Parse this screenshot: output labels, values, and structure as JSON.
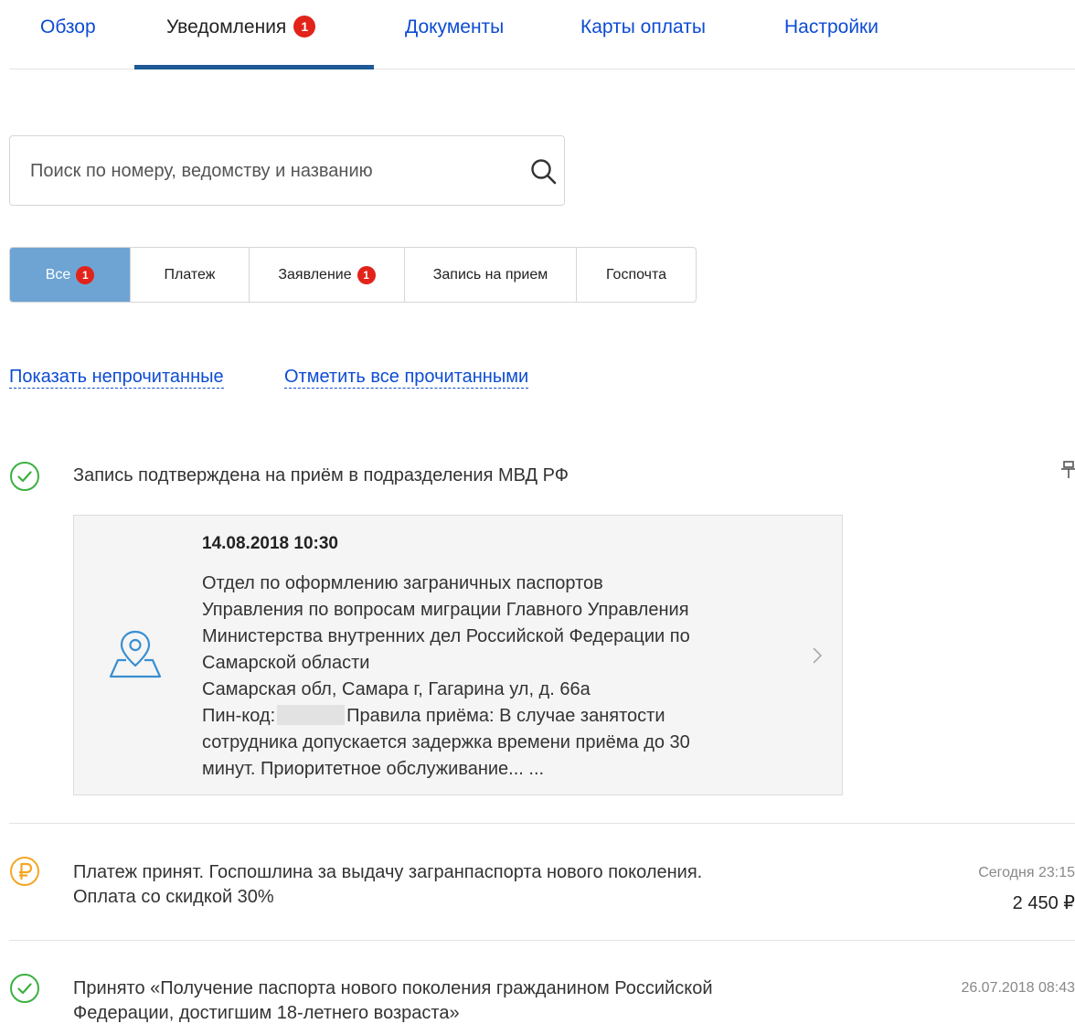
{
  "tabs": [
    {
      "label": "Обзор"
    },
    {
      "label": "Уведомления",
      "badge": "1"
    },
    {
      "label": "Документы"
    },
    {
      "label": "Карты оплаты"
    },
    {
      "label": "Настройки"
    }
  ],
  "search": {
    "placeholder": "Поиск по номеру, ведомству и названию",
    "icon": "search-icon"
  },
  "filters": [
    {
      "label": "Все",
      "badge": "1"
    },
    {
      "label": "Платеж"
    },
    {
      "label": "Заявление",
      "badge": "1"
    },
    {
      "label": "Запись на прием"
    },
    {
      "label": "Госпочта"
    }
  ],
  "links": {
    "show_unread": "Показать непрочитанные",
    "mark_all_read": "Отметить все прочитанными"
  },
  "notifications": [
    {
      "icon": "check-circle-icon",
      "text": "Запись подтверждена на приём в подразделения МВД РФ",
      "card": {
        "datetime": "14.08.2018 10:30",
        "line1": "Отдел по оформлению заграничных паспортов",
        "line2": "Управления по вопросам миграции Главного Управления",
        "line3": "Министерства внутренних дел Российской Федерации по",
        "line4": "Самарской области",
        "address": "Самарская обл, Самара г, Гагарина ул, д. 66а",
        "pin_label": "Пин-код:",
        "rules": "Правила приёма: В случае занятости",
        "rules2": "сотрудника допускается задержка времени приёма до 30",
        "rules3": "минут. Приоритетное обслуживание... ..."
      }
    },
    {
      "icon": "ruble-circle-icon",
      "text1": "Платеж принят. Госпошлина за выдачу загранпаспорта нового поколения.",
      "text2": "Оплата со скидкой 30%",
      "date": "Сегодня 23:15",
      "amount": "2 450 ₽"
    },
    {
      "icon": "check-circle-icon",
      "text1": "Принято «Получение паспорта нового поколения гражданином Российской",
      "text2": "Федерации, достигшим 18-летнего возраста»",
      "date": "26.07.2018 08:43"
    }
  ],
  "colors": {
    "link": "#0d4cd3",
    "active_filter": "#6ea4d4",
    "badge": "#e2231a",
    "success": "#3cb043",
    "payment": "#f5a623",
    "tab_underline": "#1d5a96"
  }
}
